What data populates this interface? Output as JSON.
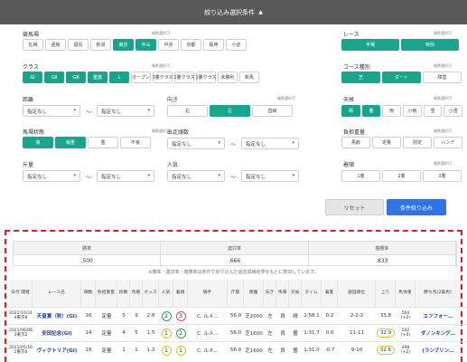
{
  "header": {
    "title": "絞り込み選択条件",
    "arrow": "▲"
  },
  "multi_note": "複数選択可",
  "racecourse": {
    "label": "競馬場",
    "items": [
      {
        "t": "札幌",
        "on": false
      },
      {
        "t": "函館",
        "on": false
      },
      {
        "t": "福島",
        "on": false
      },
      {
        "t": "新潟",
        "on": false
      },
      {
        "t": "東京",
        "on": true
      },
      {
        "t": "中山",
        "on": true
      },
      {
        "t": "中京",
        "on": false
      },
      {
        "t": "京都",
        "on": false
      },
      {
        "t": "阪神",
        "on": false
      },
      {
        "t": "小倉",
        "on": false
      }
    ]
  },
  "race": {
    "label": "レース",
    "items": [
      {
        "t": "平場",
        "on": true
      },
      {
        "t": "特別",
        "on": true
      }
    ]
  },
  "class": {
    "label": "クラス",
    "items": [
      {
        "t": "GⅠ",
        "on": true
      },
      {
        "t": "GⅡ",
        "on": true
      },
      {
        "t": "GⅢ",
        "on": true
      },
      {
        "t": "重賞",
        "on": true
      },
      {
        "t": "L",
        "on": true
      },
      {
        "t": "オープン",
        "on": false
      },
      {
        "t": "3勝クラス",
        "on": false
      },
      {
        "t": "2勝クラス",
        "on": false
      },
      {
        "t": "1勝クラス",
        "on": false
      },
      {
        "t": "未勝利",
        "on": false
      },
      {
        "t": "新馬",
        "on": false
      }
    ]
  },
  "course": {
    "label": "コース種別",
    "items": [
      {
        "t": "芝",
        "on": true
      },
      {
        "t": "ダート",
        "on": true
      },
      {
        "t": "障害",
        "on": false
      }
    ]
  },
  "distance": {
    "label": "距離",
    "from": "指定なし",
    "to": "指定なし"
  },
  "direction": {
    "label": "向き",
    "items": [
      {
        "t": "右",
        "on": false
      },
      {
        "t": "左",
        "on": true
      },
      {
        "t": "直線",
        "on": false
      }
    ]
  },
  "weather": {
    "label": "天候",
    "items": [
      {
        "t": "晴",
        "on": true
      },
      {
        "t": "曇",
        "on": true
      },
      {
        "t": "雨",
        "on": false
      },
      {
        "t": "小雨",
        "on": false
      },
      {
        "t": "雪",
        "on": false
      },
      {
        "t": "小雪",
        "on": false
      }
    ]
  },
  "track": {
    "label": "馬場状態",
    "items": [
      {
        "t": "良",
        "on": true
      },
      {
        "t": "稍重",
        "on": true
      },
      {
        "t": "重",
        "on": false
      },
      {
        "t": "不良",
        "on": false
      }
    ]
  },
  "runners": {
    "label": "出走頭数",
    "from": "指定なし",
    "to": "指定なし"
  },
  "weight_rule": {
    "label": "負担重量",
    "items": [
      {
        "t": "馬齢",
        "on": false
      },
      {
        "t": "定量",
        "on": false
      },
      {
        "t": "別定",
        "on": false
      },
      {
        "t": "ハンデ",
        "on": false
      }
    ]
  },
  "gate": {
    "label": "斤量",
    "from": "指定なし",
    "to": "指定なし"
  },
  "popularity": {
    "label": "人気",
    "from": "指定なし",
    "to": "指定なし"
  },
  "frame": {
    "label": "着順",
    "items": [
      {
        "t": "1着",
        "on": false
      },
      {
        "t": "2着",
        "on": false
      },
      {
        "t": "3着",
        "on": false
      }
    ]
  },
  "tilde": "〜",
  "caret": "▾",
  "buttons": {
    "reset": "リセット",
    "apply": "条件絞り込み"
  },
  "stats": {
    "headers": [
      "勝率",
      "連対率",
      "複勝率"
    ],
    "values": [
      ".500",
      ".666",
      ".833"
    ]
  },
  "stats_note": "※勝率・連対率・複勝率は条件で絞り込んだ過去成績結果をもとに算出しています。",
  "table": {
    "headers": [
      "日付\n開催",
      "レース名",
      "頭数",
      "負担重量",
      "枠番",
      "馬番",
      "オッズ",
      "人気",
      "着順",
      "騎手",
      "斤量",
      "距離",
      "向き",
      "馬場",
      "天候",
      "タイム",
      "着差",
      "通過順位",
      "上り",
      "馬体重",
      "勝ち馬(2着馬)"
    ],
    "rows": [
      {
        "date": "2021/10/31",
        "meet": "4東京8",
        "race": "天皇賞（秋）(GⅠ)",
        "n": "16",
        "w": "定量",
        "f": "5",
        "b": "9",
        "o": "2.8",
        "pop": "2",
        "rank": "3",
        "j": "C. ルメ…",
        "kg": "56.0",
        "dist": "芝2000",
        "dir": "左",
        "trk": "良",
        "wx": "晴",
        "time": "1:58.1",
        "diff": "0.2",
        "pass": "2-2-2",
        "up": "33.8",
        "bw": "504",
        "bwd": "(+2)",
        "win": "エフフォー…"
      },
      {
        "date": "2021/06/06",
        "meet": "3東京2",
        "race": "安田記念(GⅠ)",
        "n": "14",
        "w": "定量",
        "f": "4",
        "b": "5",
        "o": "1.5",
        "pop": "1",
        "rank": "2",
        "j": "C. ルメ…",
        "kg": "56.0",
        "dist": "芝1600",
        "dir": "左",
        "trk": "良",
        "wx": "曇",
        "time": "1:31.7",
        "diff": "0.0",
        "pass": "11-11",
        "up": "32.9",
        "bw": "502",
        "bwd": "(+4)",
        "win": "ダノンキング…"
      },
      {
        "date": "2021/05/16",
        "meet": "2東京8",
        "race": "ヴィクトリア(GⅠ)",
        "n": "18",
        "w": "定量",
        "f": "1",
        "b": "1",
        "o": "1.3",
        "pop": "1",
        "rank": "1",
        "j": "C. ルメ…",
        "kg": "56.0",
        "dist": "芝1600",
        "dir": "左",
        "trk": "良",
        "wx": "曇",
        "time": "1:31.0",
        "diff": "-0.7",
        "pass": "9-10",
        "up": "32.6",
        "bw": "498",
        "bwd": "(+2)",
        "win": "(ランブリン…"
      }
    ]
  },
  "colors": {
    "accent": "#18a58c",
    "header": "#595959",
    "apply": "#2e74e6",
    "highlight": "#e21b1b"
  }
}
